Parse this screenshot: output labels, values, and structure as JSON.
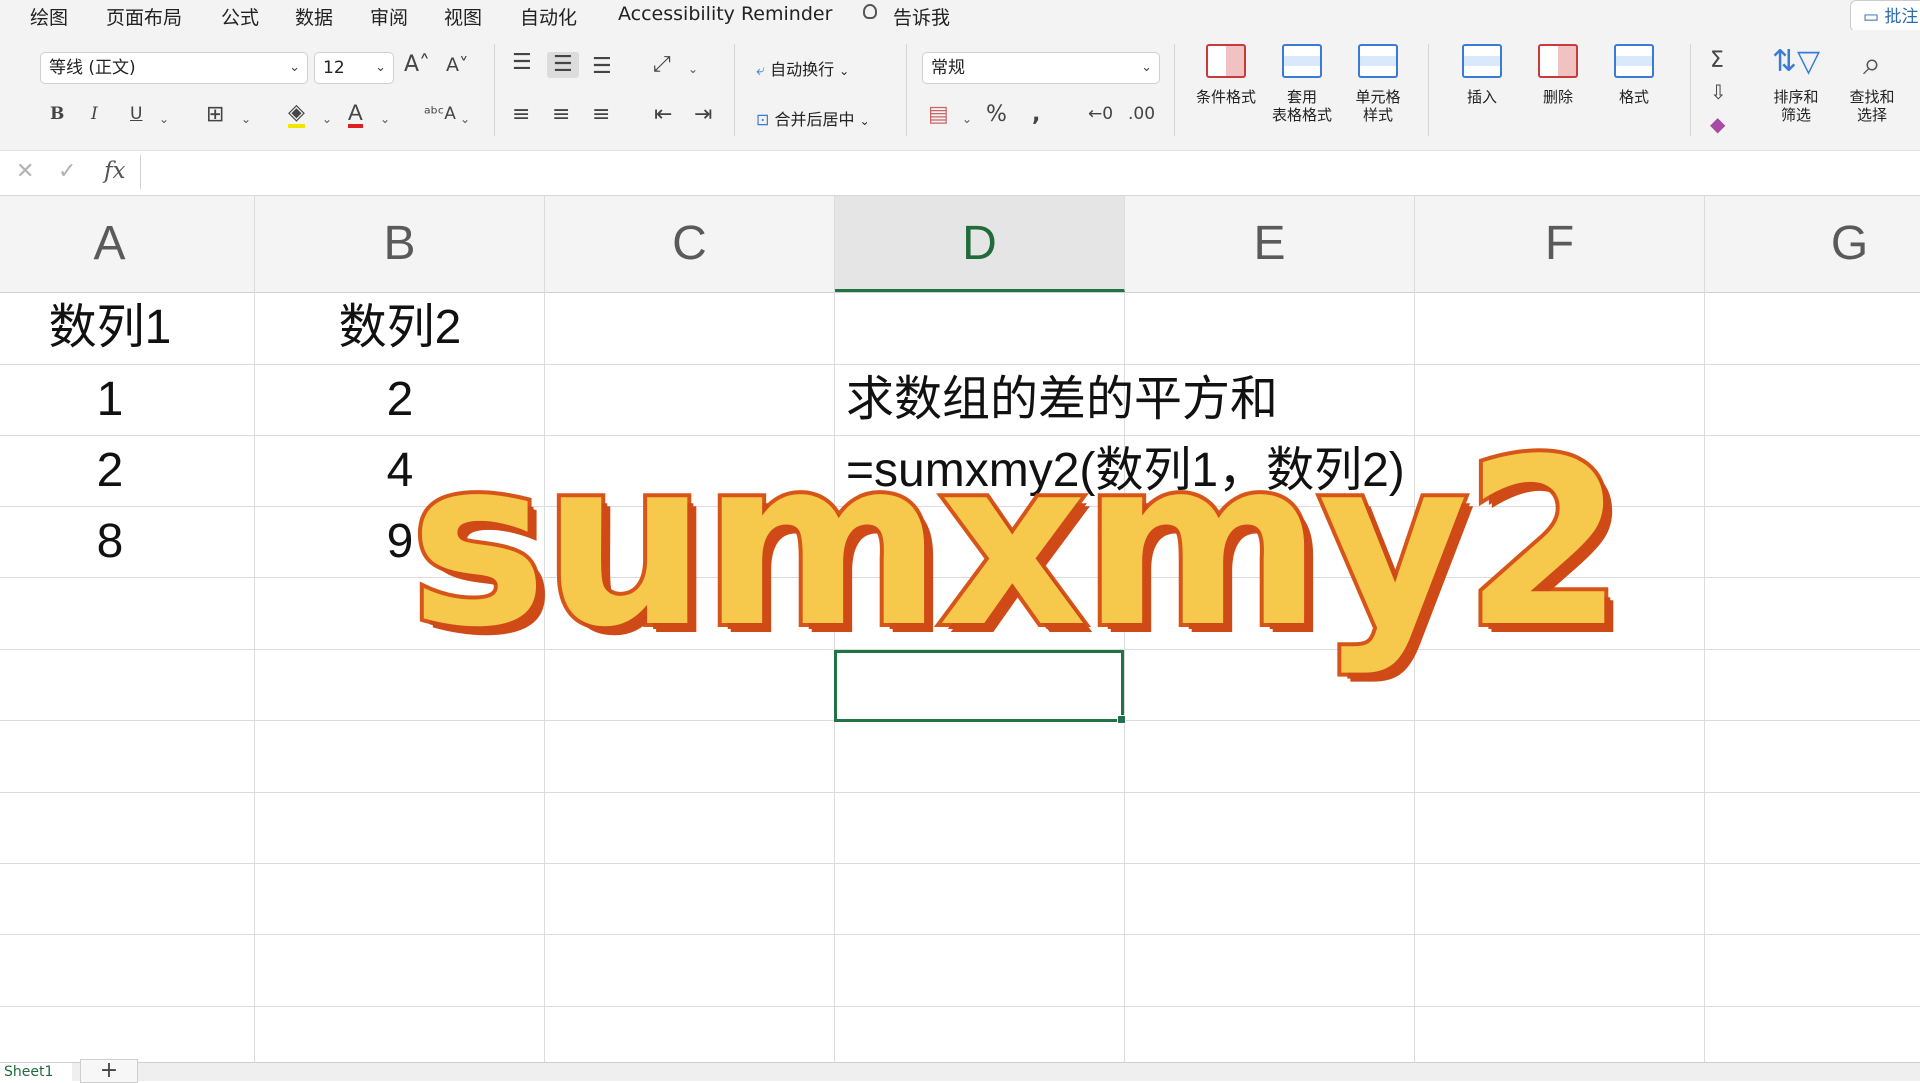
{
  "menu": {
    "items": [
      "绘图",
      "页面布局",
      "公式",
      "数据",
      "审阅",
      "视图",
      "自动化",
      "Accessibility Reminder"
    ],
    "tell_me": "告诉我",
    "comments": "批注"
  },
  "toolbar": {
    "font_name": "等线 (正文)",
    "font_size": "12",
    "number_format": "常规",
    "wrap_text": "自动换行",
    "merge_center": "合并后居中",
    "conditional_format": "条件格式",
    "table_format": "套用\n表格格式",
    "cell_style": "单元格\n样式",
    "insert": "插入",
    "delete": "删除",
    "format": "格式",
    "sort_filter": "排序和\n筛选",
    "find_select": "查找和\n选择"
  },
  "formula_bar": {
    "fx": "fx"
  },
  "columns": [
    "A",
    "B",
    "C",
    "D",
    "E",
    "F",
    "G"
  ],
  "active_column": "D",
  "cells": {
    "A1": "数列1",
    "B1": "数列2",
    "A2": "1",
    "B2": "2",
    "A3": "2",
    "B3": "4",
    "A4": "8",
    "B4": "9",
    "D2": "求数组的差的平方和",
    "D3": "=sumxmy2(数列1，数列2)"
  },
  "overlay_title": "sumxmy2",
  "sheet_tab": "Sheet1",
  "add_sheet": "+",
  "colors": {
    "accent": "#217346",
    "overlay_fill": "#f6c84b",
    "overlay_stroke": "#d8551a"
  }
}
